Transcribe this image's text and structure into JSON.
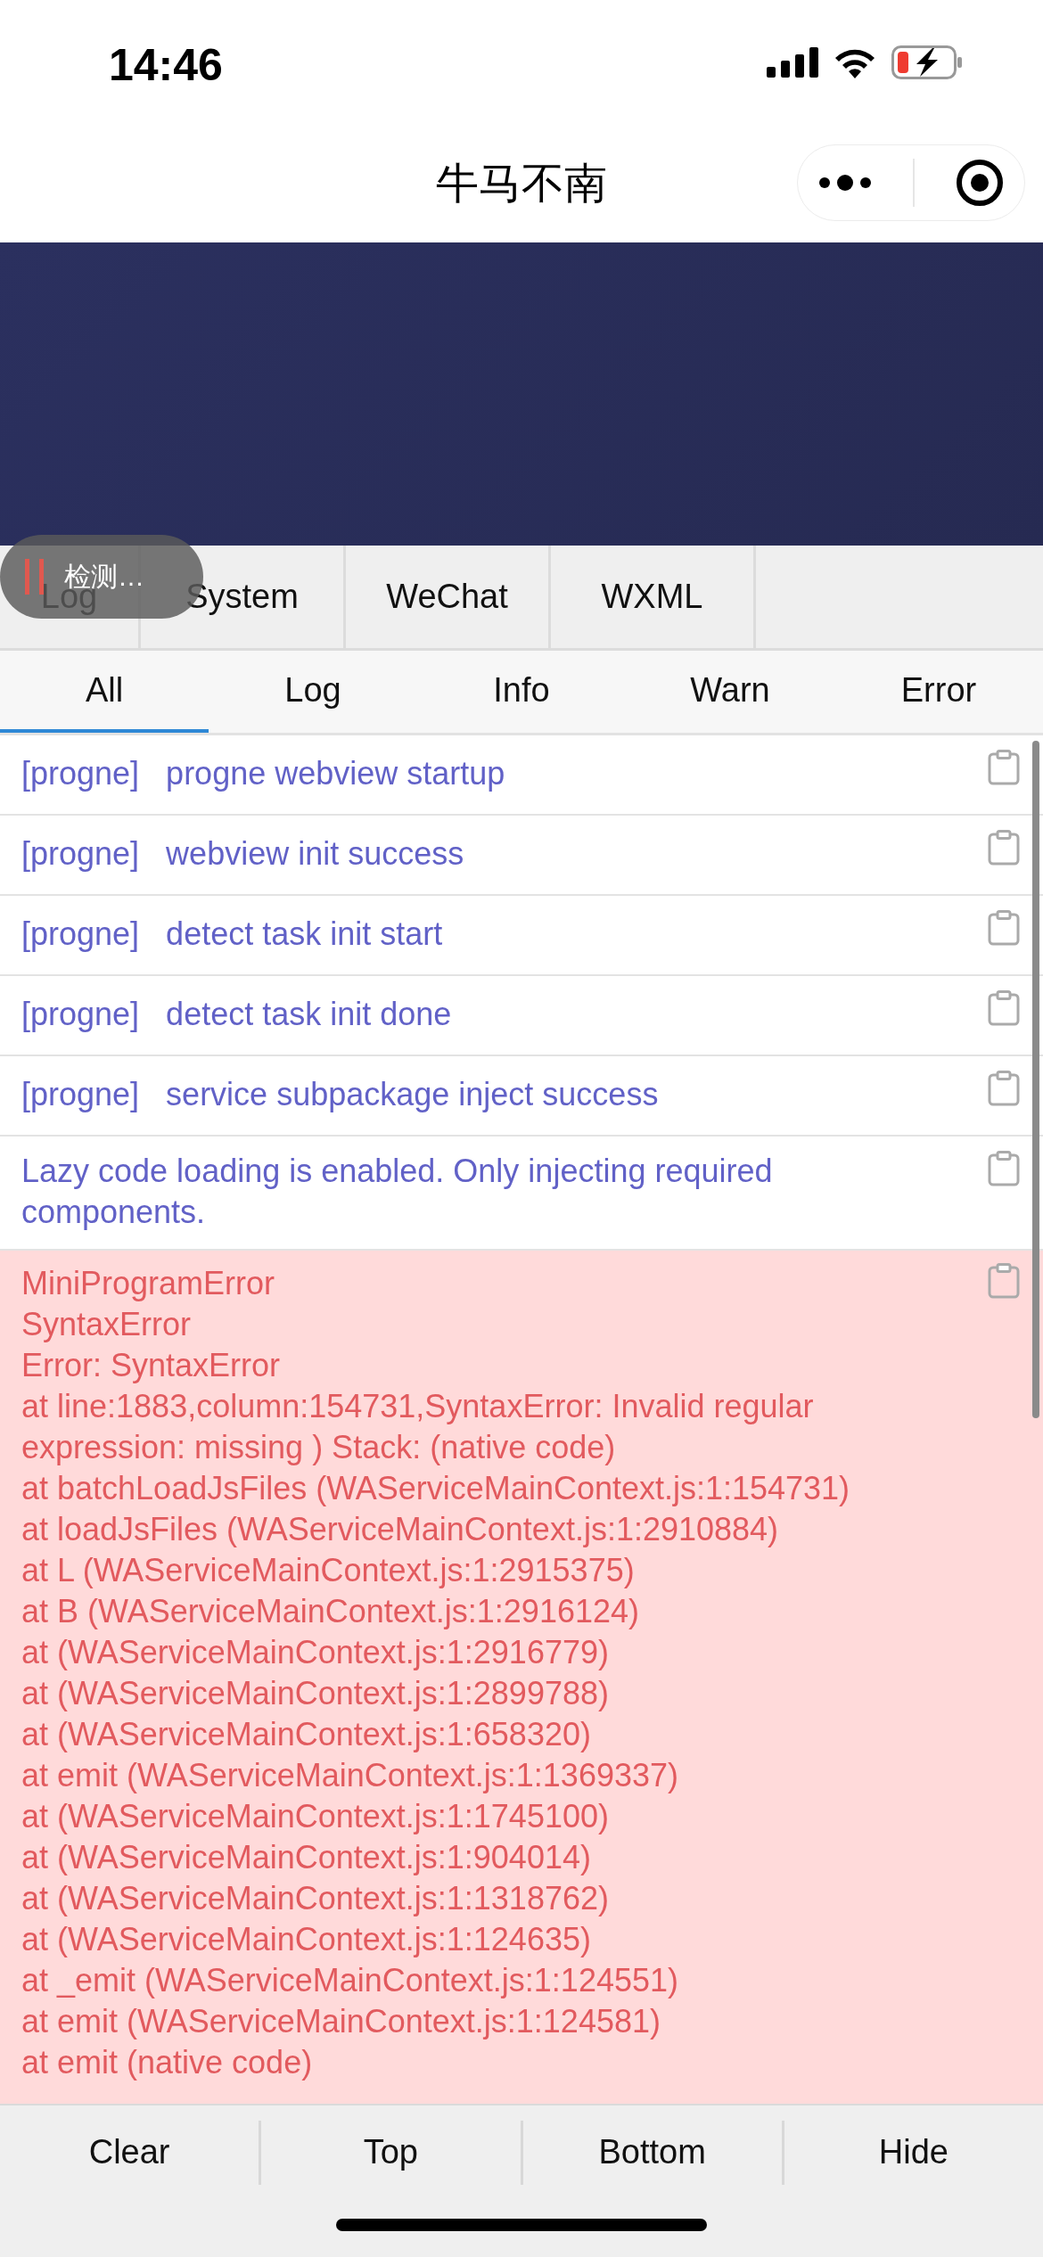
{
  "status_bar": {
    "time": "14:46"
  },
  "nav": {
    "title": "牛马不南"
  },
  "toast": {
    "text": "检测…"
  },
  "tabs": [
    "Log",
    "System",
    "WeChat",
    "WXML"
  ],
  "filters": [
    {
      "label": "All",
      "selected": true
    },
    {
      "label": "Log",
      "selected": false
    },
    {
      "label": "Info",
      "selected": false
    },
    {
      "label": "Warn",
      "selected": false
    },
    {
      "label": "Error",
      "selected": false
    }
  ],
  "entries": [
    {
      "kind": "log",
      "tag": "[progne]",
      "lines": [
        "progne webview startup"
      ]
    },
    {
      "kind": "log",
      "tag": "[progne]",
      "lines": [
        "webview init success"
      ]
    },
    {
      "kind": "log",
      "tag": "[progne]",
      "lines": [
        "detect task init start"
      ]
    },
    {
      "kind": "log",
      "tag": "[progne]",
      "lines": [
        "detect task init done"
      ]
    },
    {
      "kind": "log",
      "tag": "[progne]",
      "lines": [
        "service subpackage inject success"
      ]
    },
    {
      "kind": "log",
      "lines": [
        "Lazy code loading is enabled. Only injecting required components."
      ]
    },
    {
      "kind": "error",
      "lines": [
        "MiniProgramError",
        "SyntaxError",
        "Error: SyntaxError",
        "at line:1883,column:154731,SyntaxError: Invalid regular expression: missing ) Stack: (native code)",
        "at batchLoadJsFiles (WAServiceMainContext.js:1:154731)",
        "at loadJsFiles (WAServiceMainContext.js:1:2910884)",
        "at L (WAServiceMainContext.js:1:2915375)",
        "at B (WAServiceMainContext.js:1:2916124)",
        "at  (WAServiceMainContext.js:1:2916779)",
        "at  (WAServiceMainContext.js:1:2899788)",
        "at  (WAServiceMainContext.js:1:658320)",
        "at emit (WAServiceMainContext.js:1:1369337)",
        "at  (WAServiceMainContext.js:1:1745100)",
        "at  (WAServiceMainContext.js:1:904014)",
        "at  (WAServiceMainContext.js:1:1318762)",
        "at  (WAServiceMainContext.js:1:124635)",
        "at _emit (WAServiceMainContext.js:1:124551)",
        "at emit (WAServiceMainContext.js:1:124581)",
        "at emit (native code)"
      ]
    }
  ],
  "toolbar": [
    "Clear",
    "Top",
    "Bottom",
    "Hide"
  ]
}
